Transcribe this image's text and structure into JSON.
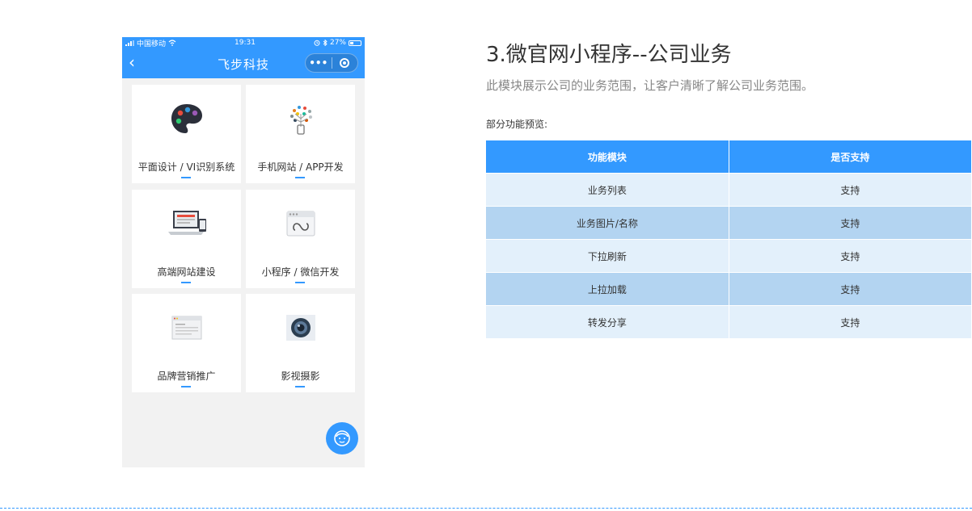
{
  "phone": {
    "status": {
      "carrier": "中国移动",
      "time": "19:31",
      "battery": "27%"
    },
    "nav": {
      "back": "‹",
      "title": "飞步科技",
      "more": "•••"
    },
    "cards": [
      {
        "label": "平面设计 / VI识别系统",
        "icon": "palette-icon"
      },
      {
        "label": "手机网站 / APP开发",
        "icon": "idea-tree-icon"
      },
      {
        "label": "高端网站建设",
        "icon": "devices-icon"
      },
      {
        "label": "小程序 / 微信开发",
        "icon": "mini-program-icon"
      },
      {
        "label": "品牌营销推广",
        "icon": "browser-page-icon"
      },
      {
        "label": "影视摄影",
        "icon": "camera-lens-icon"
      }
    ],
    "fab_icon": "customer-service-icon"
  },
  "info": {
    "heading": "3.微官网小程序--公司业务",
    "desc": "此模块展示公司的业务范围，让客户清晰了解公司业务范围。",
    "preview_label": "部分功能预览:",
    "table": {
      "headers": [
        "功能模块",
        "是否支持"
      ],
      "rows": [
        [
          "业务列表",
          "支持"
        ],
        [
          "业务图片/名称",
          "支持"
        ],
        [
          "下拉刷新",
          "支持"
        ],
        [
          "上拉加载",
          "支持"
        ],
        [
          "转发分享",
          "支持"
        ]
      ]
    }
  },
  "colors": {
    "accent": "#3399ff",
    "row_light": "#e3f0fb",
    "row_dark": "#b3d4f1",
    "phone_bg": "#f2f2f2"
  }
}
